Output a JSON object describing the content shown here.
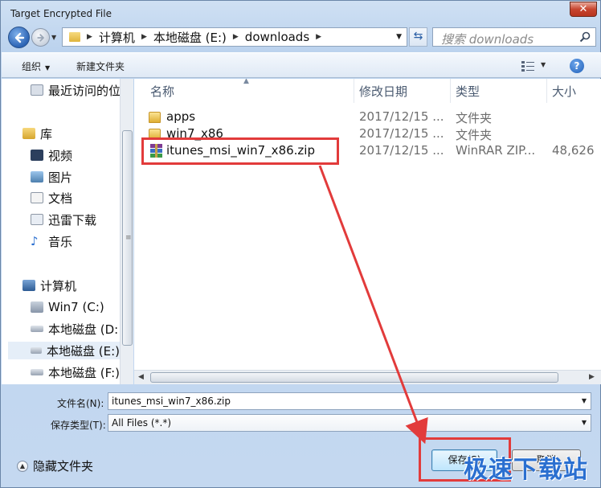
{
  "window": {
    "title": "Target Encrypted File",
    "close_glyph": "✕"
  },
  "address": {
    "crumbs": [
      "计算机",
      "本地磁盘 (E:)",
      "downloads"
    ],
    "search_placeholder": "搜索 downloads"
  },
  "toolbar": {
    "organize": "组织",
    "new_folder": "新建文件夹",
    "help_glyph": "?"
  },
  "nav": {
    "items": [
      {
        "label": "最近访问的位",
        "icon": "recent-places-icon"
      },
      {
        "label": "库",
        "icon": "libraries-icon"
      },
      {
        "label": "视频",
        "icon": "video-icon"
      },
      {
        "label": "图片",
        "icon": "pictures-icon"
      },
      {
        "label": "文档",
        "icon": "documents-icon"
      },
      {
        "label": "迅雷下载",
        "icon": "thunder-download-icon"
      },
      {
        "label": "音乐",
        "icon": "music-icon"
      },
      {
        "label": "计算机",
        "icon": "computer-icon"
      },
      {
        "label": "Win7 (C:)",
        "icon": "drive-icon"
      },
      {
        "label": "本地磁盘 (D:",
        "icon": "drive-icon"
      },
      {
        "label": "本地磁盘 (E:)",
        "icon": "drive-icon"
      },
      {
        "label": "本地磁盘 (F:)",
        "icon": "drive-icon"
      }
    ],
    "selected_index": 10
  },
  "files": {
    "columns": [
      "名称",
      "修改日期",
      "类型",
      "大小"
    ],
    "rows": [
      {
        "name": "apps",
        "date": "2017/12/15 ...",
        "type": "文件夹",
        "size": "",
        "icon": "folder-icon"
      },
      {
        "name": "win7_x86",
        "date": "2017/12/15 ...",
        "type": "文件夹",
        "size": "",
        "icon": "folder-icon"
      },
      {
        "name": "itunes_msi_win7_x86.zip",
        "date": "2017/12/15 ...",
        "type": "WinRAR ZIP...",
        "size": "48,626",
        "icon": "winrar-zip-icon"
      }
    ]
  },
  "form": {
    "filename_label": "文件名(N):",
    "filename_value": "itunes_msi_win7_x86.zip",
    "filetype_label": "保存类型(T):",
    "filetype_value": "All Files (*.*)"
  },
  "footer": {
    "hide_folders": "隐藏文件夹",
    "save": "保存(S)",
    "cancel": "取消"
  },
  "annotation": {
    "watermark": "极速下载站",
    "highlight_color": "#e23b3b"
  }
}
